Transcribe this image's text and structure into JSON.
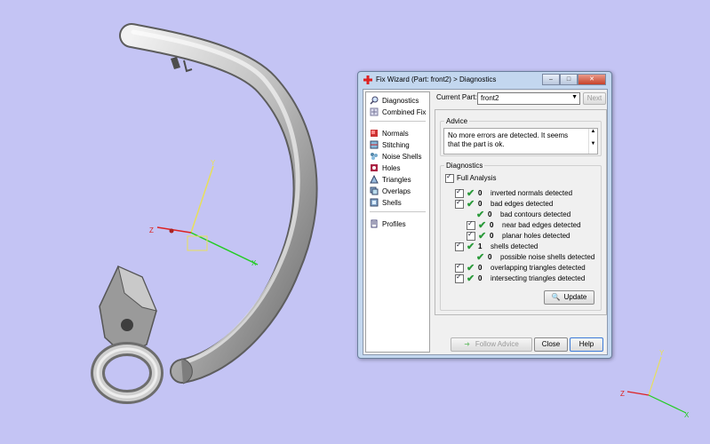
{
  "viewport": {
    "axis_z": "Z",
    "axis_y": "Y",
    "axis_x": "X",
    "mini_axis_z": "Z",
    "mini_axis_y": "Y",
    "mini_axis_x": "X"
  },
  "dialog": {
    "title": "Fix Wizard (Part: front2) > Diagnostics",
    "sidebar": [
      {
        "label": "Diagnostics",
        "icon": "magnifier-icon"
      },
      {
        "label": "Combined Fix",
        "icon": "combined-fix-icon"
      },
      {
        "label": "Normals",
        "icon": "normals-icon"
      },
      {
        "label": "Stitching",
        "icon": "stitching-icon"
      },
      {
        "label": "Noise Shells",
        "icon": "noise-shells-icon"
      },
      {
        "label": "Holes",
        "icon": "holes-icon"
      },
      {
        "label": "Triangles",
        "icon": "triangles-icon"
      },
      {
        "label": "Overlaps",
        "icon": "overlaps-icon"
      },
      {
        "label": "Shells",
        "icon": "shells-icon"
      },
      {
        "label": "Profiles",
        "icon": "profiles-icon"
      }
    ],
    "current_part_label": "Current Part:",
    "current_part_value": "front2",
    "next_label": "Next",
    "advice_title": "Advice",
    "advice_text": "No more errors are detected. It seems that the part is ok.",
    "diagnostics_title": "Diagnostics",
    "full_analysis_label": "Full Analysis",
    "rows": [
      {
        "count": "0",
        "label": "inverted normals detected",
        "indent": 0,
        "checkbox": true
      },
      {
        "count": "0",
        "label": "bad edges detected",
        "indent": 0,
        "checkbox": true
      },
      {
        "count": "0",
        "label": "bad contours detected",
        "indent": 1,
        "checkbox": false
      },
      {
        "count": "0",
        "label": "near bad edges detected",
        "indent": 1,
        "checkbox": true
      },
      {
        "count": "0",
        "label": "planar holes detected",
        "indent": 1,
        "checkbox": true
      },
      {
        "count": "1",
        "label": "shells detected",
        "indent": 0,
        "checkbox": true
      },
      {
        "count": "0",
        "label": "possible noise shells detected",
        "indent": 1,
        "checkbox": false
      },
      {
        "count": "0",
        "label": "overlapping triangles detected",
        "indent": 0,
        "checkbox": true
      },
      {
        "count": "0",
        "label": "intersecting triangles detected",
        "indent": 0,
        "checkbox": true
      }
    ],
    "update_label": "Update",
    "follow_advice_label": "Follow Advice",
    "close_label": "Close",
    "help_label": "Help"
  }
}
